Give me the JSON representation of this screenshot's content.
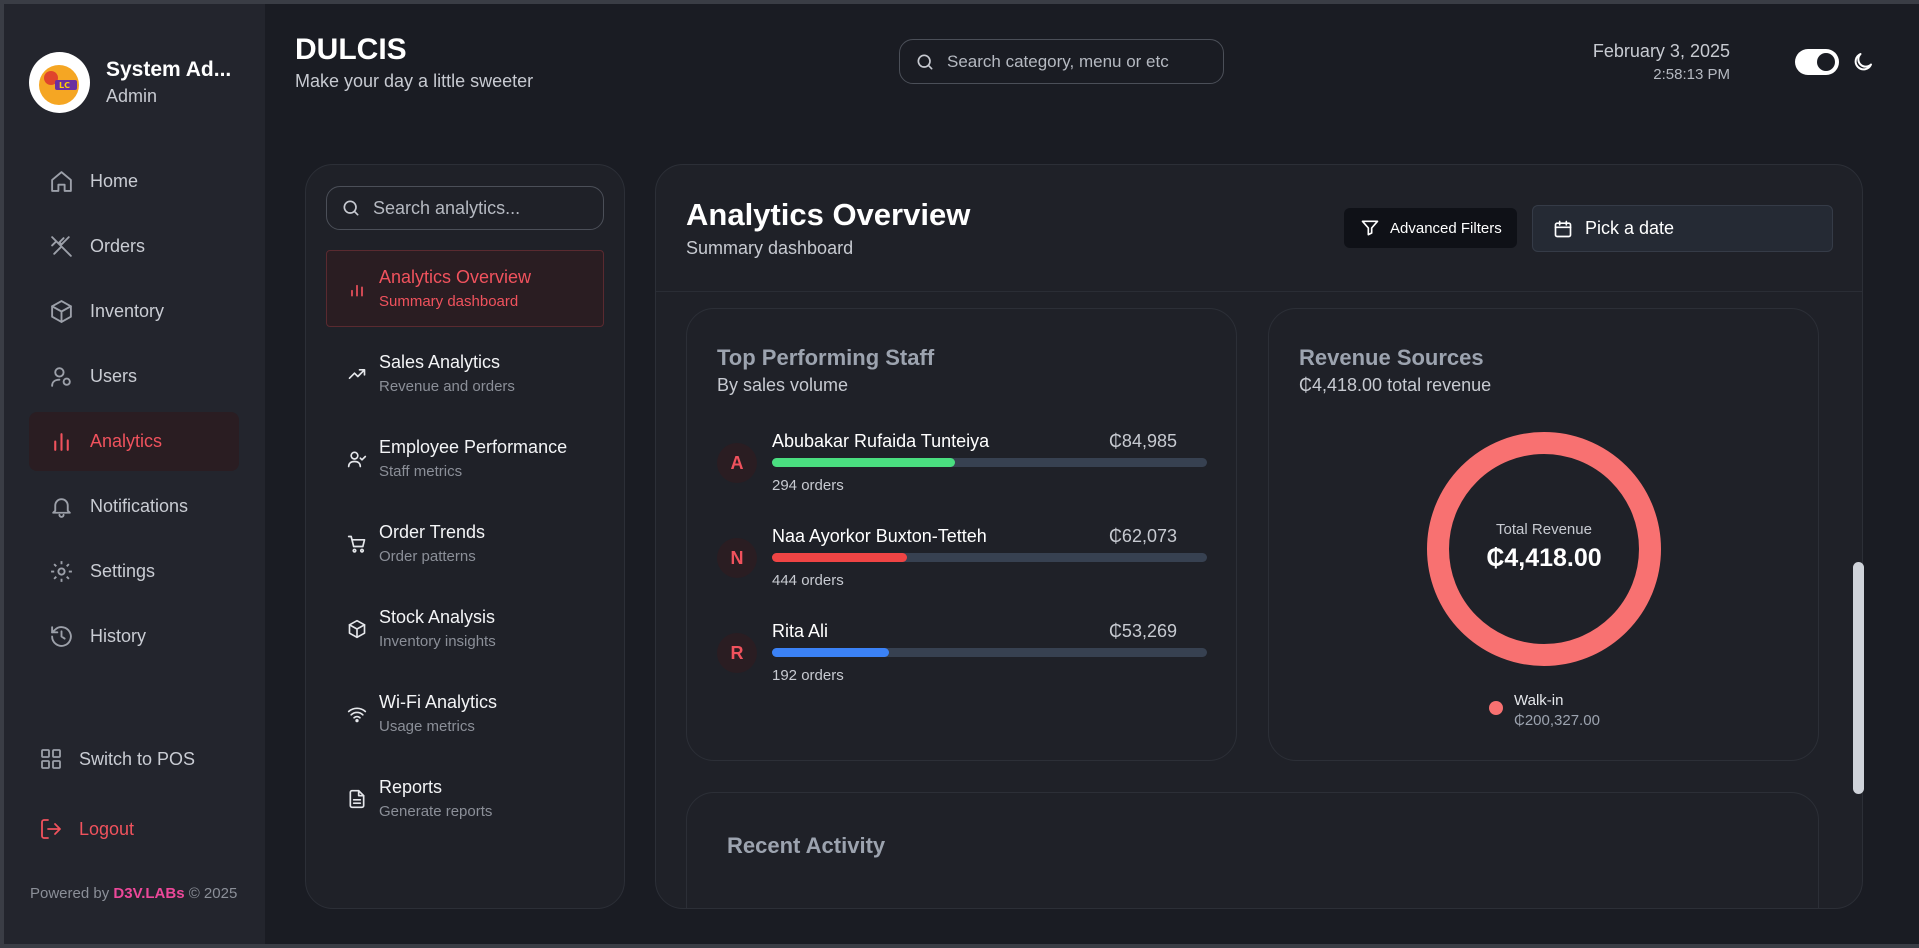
{
  "sidebar": {
    "user_name": "System Ad...",
    "user_role": "Admin",
    "items": [
      {
        "label": "Home",
        "icon": "home-icon"
      },
      {
        "label": "Orders",
        "icon": "utensils-icon"
      },
      {
        "label": "Inventory",
        "icon": "box-icon"
      },
      {
        "label": "Users",
        "icon": "users-icon"
      },
      {
        "label": "Analytics",
        "icon": "chart-icon",
        "active": true
      },
      {
        "label": "Notifications",
        "icon": "bell-icon"
      },
      {
        "label": "Settings",
        "icon": "gear-icon"
      },
      {
        "label": "History",
        "icon": "history-icon"
      }
    ],
    "switch_pos": "Switch to POS",
    "logout": "Logout",
    "powered_prefix": "Powered by",
    "powered_brand": "D3V.LABs",
    "powered_suffix": "© 2025"
  },
  "header": {
    "title": "DULCIS",
    "subtitle": "Make your day a little sweeter",
    "search_placeholder": "Search category, menu or etc",
    "date": "February 3, 2025",
    "time": "2:58:13 PM"
  },
  "analytics_nav": {
    "search_placeholder": "Search analytics...",
    "items": [
      {
        "title": "Analytics Overview",
        "desc": "Summary dashboard",
        "icon": "bar-chart-icon",
        "active": true
      },
      {
        "title": "Sales Analytics",
        "desc": "Revenue and orders",
        "icon": "trending-up-icon"
      },
      {
        "title": "Employee Performance",
        "desc": "Staff metrics",
        "icon": "user-check-icon"
      },
      {
        "title": "Order Trends",
        "desc": "Order patterns",
        "icon": "cart-icon"
      },
      {
        "title": "Stock Analysis",
        "desc": "Inventory insights",
        "icon": "package-icon"
      },
      {
        "title": "Wi-Fi Analytics",
        "desc": "Usage metrics",
        "icon": "wifi-icon"
      },
      {
        "title": "Reports",
        "desc": "Generate reports",
        "icon": "file-icon"
      }
    ]
  },
  "main": {
    "title": "Analytics Overview",
    "subtitle": "Summary dashboard",
    "filters_label": "Advanced Filters",
    "date_label": "Pick a date"
  },
  "staff": {
    "title": "Top Performing Staff",
    "subtitle": "By sales volume",
    "rows": [
      {
        "initial": "A",
        "name": "Abubakar Rufaida Tunteiya",
        "amount": "₵84,985",
        "orders": "294 orders",
        "progress": 0.42,
        "color": "#4ade80"
      },
      {
        "initial": "N",
        "name": "Naa Ayorkor Buxton-Tetteh",
        "amount": "₵62,073",
        "orders": "444 orders",
        "progress": 0.31,
        "color": "#ef4444"
      },
      {
        "initial": "R",
        "name": "Rita Ali",
        "amount": "₵53,269",
        "orders": "192 orders",
        "progress": 0.27,
        "color": "#3b82f6"
      }
    ]
  },
  "revenue": {
    "title": "Revenue Sources",
    "subtitle": "₵4,418.00 total revenue",
    "center_label": "Total Revenue",
    "center_value": "₵4,418.00",
    "legend_name": "Walk-in",
    "legend_value": "₵200,327.00",
    "color": "#f87171"
  },
  "activity": {
    "title": "Recent Activity"
  }
}
